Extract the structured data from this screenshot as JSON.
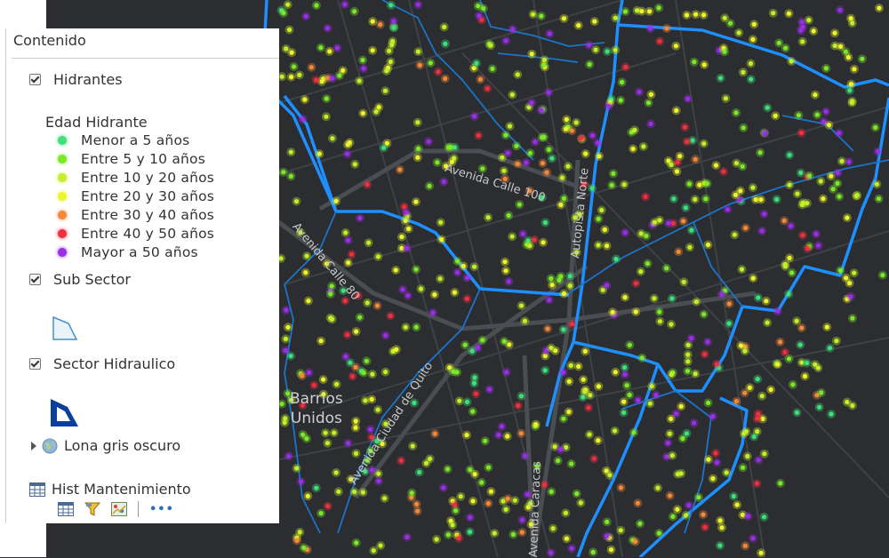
{
  "panel": {
    "title": "Contenido",
    "layers": [
      {
        "label": "Hidrantes",
        "checked": true
      },
      {
        "label": "Sub Sector",
        "checked": true
      },
      {
        "label": "Sector Hidraulico",
        "checked": true
      }
    ],
    "legend_title": "Edad Hidrante",
    "legend": [
      {
        "label": "Menor a 5 años",
        "color": "#3ee07a"
      },
      {
        "label": "Entre 5 y 10 años",
        "color": "#7de82a"
      },
      {
        "label": "Entre 10 y 20 años",
        "color": "#c3ee2a"
      },
      {
        "label": "Entre 20 y 30 años",
        "color": "#ecf52c"
      },
      {
        "label": "Entre 30 y 40 años",
        "color": "#f28a3a"
      },
      {
        "label": "Entre 40 y 50 años",
        "color": "#f03040"
      },
      {
        "label": "Mayor a 50 años",
        "color": "#9b2fe8"
      }
    ],
    "basemap": "Lona gris oscuro",
    "table": "Hist Mantenimiento",
    "more": "•••"
  },
  "map": {
    "labels": [
      "Avenida Calle 100",
      "Autopista Norte",
      "Avenida Calle 80",
      "Avenida Ciudad de Quito",
      "Avenida Caracas"
    ],
    "area_label": [
      "Barrios",
      "Unidos"
    ],
    "boundary_color": "#1e8fff"
  }
}
